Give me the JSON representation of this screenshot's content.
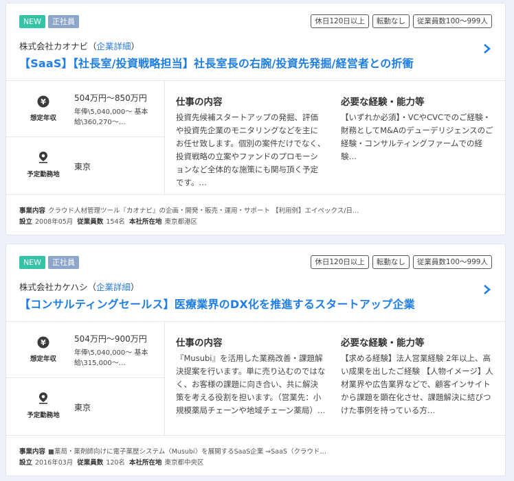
{
  "icons": {
    "salary": "yen-icon",
    "location": "map-pin-icon",
    "chevron": "chevron-right-icon"
  },
  "colors": {
    "new_badge": "#34c3a4",
    "type_badge": "#8fa6cc",
    "title_link": "#1e7ee3",
    "company_link": "#2a7bd6"
  },
  "jobs": [
    {
      "new_label": "NEW",
      "type_label": "正社員",
      "tags": [
        "休日120日以上",
        "転勤なし",
        "従業員数100〜999人"
      ],
      "company_name": "株式会社カオナビ（",
      "company_link": "企業詳細",
      "company_close": "）",
      "title": "【SaaS】【社長室/投資戦略担当】社長室長の右腕/投資先発掘/経営者との折衝",
      "salary_label": "想定年収",
      "salary_range": "504万円〜850万円",
      "salary_detail": "年俸\\5,040,000〜 基本給\\360,270〜…",
      "location_label": "予定勤務地",
      "location": "東京",
      "duty_title": "仕事の内容",
      "duty_text": "投資先候補スタートアップの発掘、評価や投資先企業のモニタリングなどを主にお任せ致します。個別の案件だけでなく、投資戦略の立案やファンドのプロモーションなど全体的な施策にも関与頂く予定です。…",
      "req_title": "必要な経験・能力等",
      "req_text": "【いずれか必須】・VCやCVCでのご経験・財務としてM&Aのデューデリジェンスのご経験・コンサルティングファームでの経験…",
      "biz_label": "事業内容",
      "biz_text": "クラウド人材管理ツール『カオナビ』の企画・開発・販売・運用・サポート 【利用例】エイペックス/日…",
      "founded_label": "設立",
      "founded": "2008年05月",
      "employees_label": "従業員数",
      "employees": "154名",
      "hq_label": "本社所在地",
      "hq": "東京都港区"
    },
    {
      "new_label": "NEW",
      "type_label": "正社員",
      "tags": [
        "休日120日以上",
        "転勤なし",
        "従業員数100〜999人"
      ],
      "company_name": "株式会社カケハシ（",
      "company_link": "企業詳細",
      "company_close": "）",
      "title": "【コンサルティングセールス】医療業界のDX化を推進するスタートアップ企業",
      "salary_label": "想定年収",
      "salary_range": "504万円〜900万円",
      "salary_detail": "年俸\\5,040,000〜 基本給\\315,000〜…",
      "location_label": "予定勤務地",
      "location": "東京",
      "duty_title": "仕事の内容",
      "duty_text": "『Musubi』を活用した業務改善・課題解決提案を行います。単に売り込むのではなく、お客様の課題に向き合い、共に解決策を考える役割を担います。（営業先：小規模薬局チェーンや地域チェーン薬局）…",
      "req_title": "必要な経験・能力等",
      "req_text": "【求める経験】法人営業経験 2年以上、高い成果を出したご経験 【人物イメージ】人材業界や広告業界などで、顧客インサイトから課題を顕在化させ、課題解決に結びつけた事例を持っている方…",
      "biz_label": "事業内容",
      "biz_text": "■薬局・薬剤師向けに電子薬歴システム〈Musubi〉を展開するSaaS企業 ⇒SaaS（クラウド…",
      "founded_label": "設立",
      "founded": "2016年03月",
      "employees_label": "従業員数",
      "employees": "120名",
      "hq_label": "本社所在地",
      "hq": "東京都中央区"
    }
  ]
}
